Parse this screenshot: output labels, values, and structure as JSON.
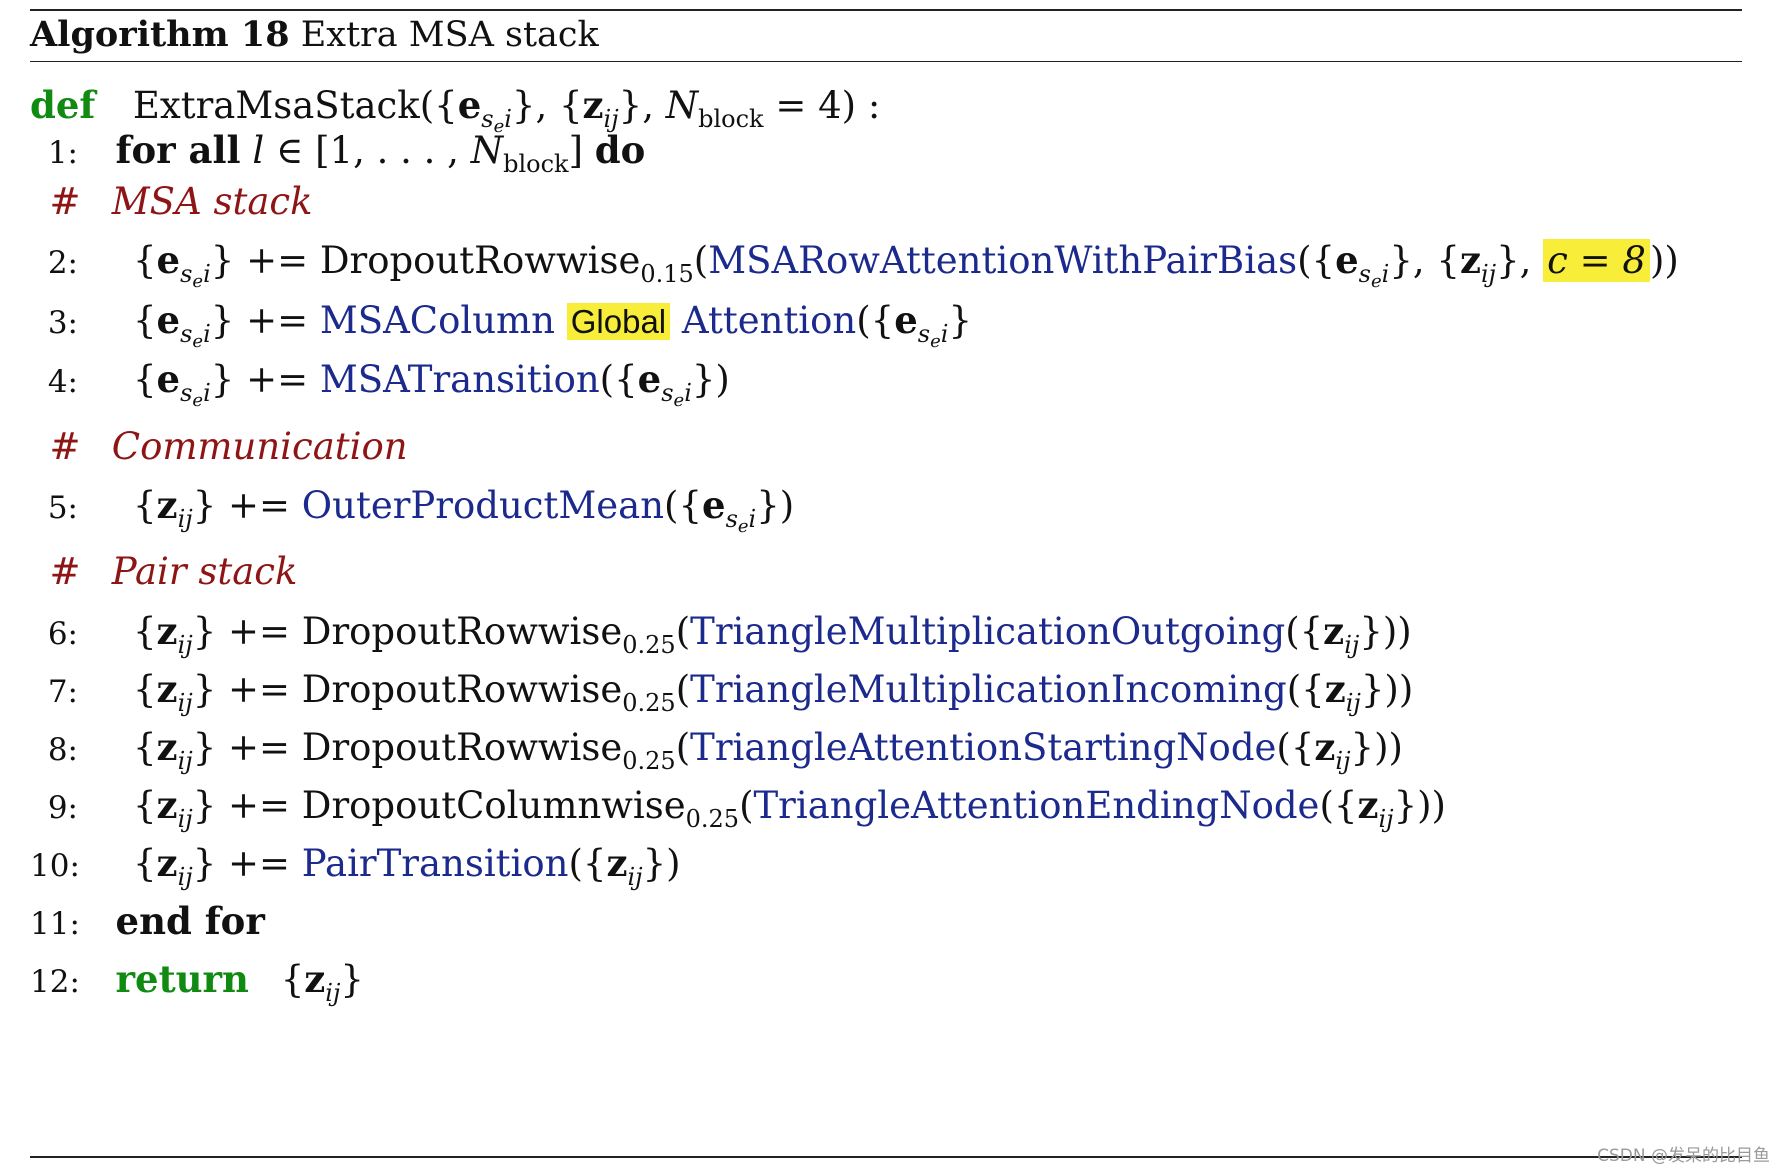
{
  "algorithm": {
    "label": "Algorithm 18",
    "title": "Extra MSA stack"
  },
  "signature": {
    "keyword": "def",
    "name": "ExtraMsaStack",
    "default_n_block": "4"
  },
  "keywords": {
    "for_all": "for all",
    "do": "do",
    "end_for": "end for",
    "return": "return"
  },
  "comments": {
    "hash": "#",
    "msa_stack": "MSA stack",
    "communication": "Communication",
    "pair_stack": "Pair stack"
  },
  "line_numbers": [
    "1:",
    "2:",
    "3:",
    "4:",
    "5:",
    "6:",
    "7:",
    "8:",
    "9:",
    "10:",
    "11:",
    "12:"
  ],
  "ops": {
    "plus_eq": "+=",
    "dropout_rowwise": "DropoutRowwise",
    "dropout_columnwise": "DropoutColumnwise",
    "rate_015": "0.15",
    "rate_025": "0.25"
  },
  "functions": {
    "msa_row_attention": "MSARowAttentionWithPairBias",
    "msa_column_pre": "MSAColumn",
    "msa_column_global": "Global",
    "msa_column_post": "Attention",
    "msa_transition": "MSATransition",
    "outer_product_mean": "OuterProductMean",
    "tri_mult_out": "TriangleMultiplicationOutgoing",
    "tri_mult_in": "TriangleMultiplicationIncoming",
    "tri_att_start": "TriangleAttentionStartingNode",
    "tri_att_end": "TriangleAttentionEndingNode",
    "pair_transition": "PairTransition"
  },
  "highlight_c": "c = 8",
  "watermark": "CSDN @发呆的比目鱼",
  "colors": {
    "keyword_green": "#118a11",
    "function_blue": "#1b2a8c",
    "comment_red": "#8e1515",
    "highlight_yellow": "#f8ee3a"
  }
}
